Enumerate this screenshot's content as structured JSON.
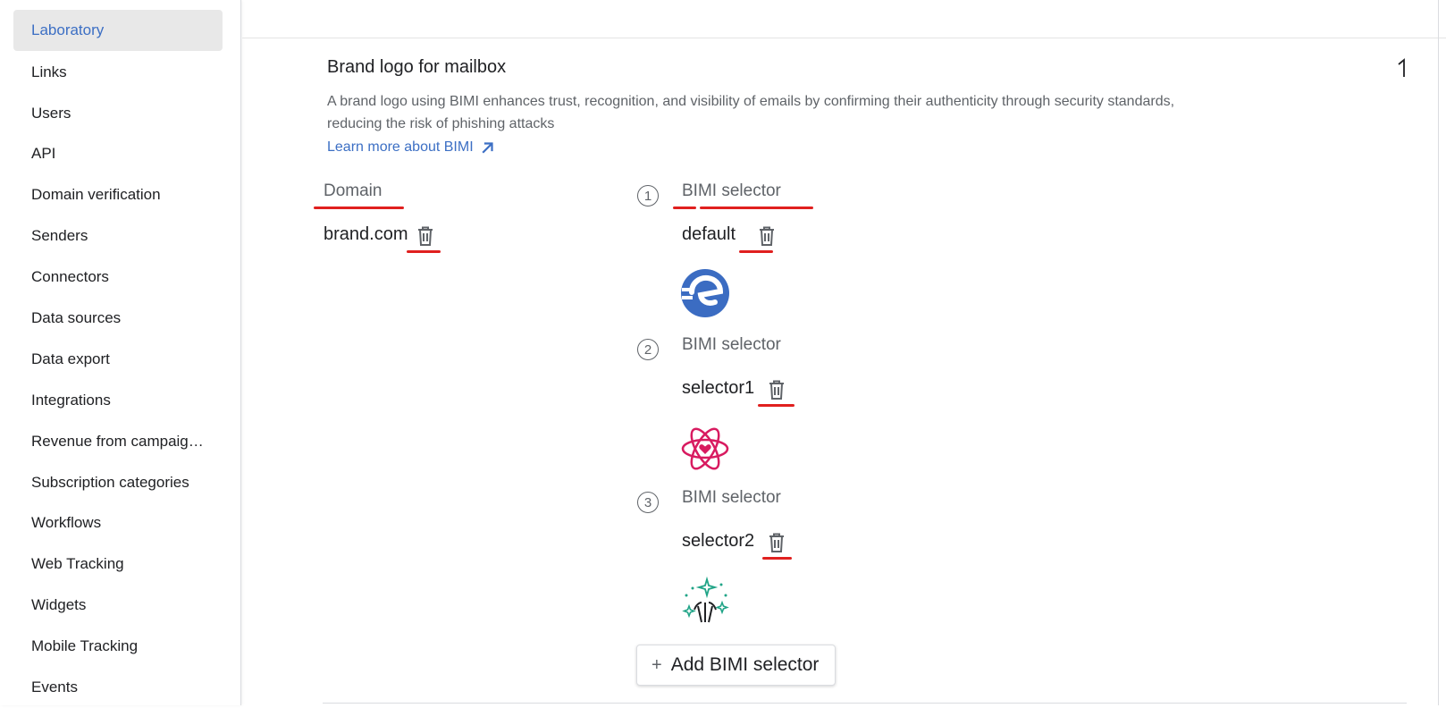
{
  "sidebar": {
    "items": [
      {
        "label": "Laboratory",
        "active": true
      },
      {
        "label": "Links"
      },
      {
        "label": "Users"
      },
      {
        "label": "API"
      },
      {
        "label": "Domain verification"
      },
      {
        "label": "Senders"
      },
      {
        "label": "Connectors"
      },
      {
        "label": "Data sources"
      },
      {
        "label": "Data export"
      },
      {
        "label": "Integrations"
      },
      {
        "label": "Revenue from campaig…"
      },
      {
        "label": "Subscription categories"
      },
      {
        "label": "Workflows"
      },
      {
        "label": "Web Tracking"
      },
      {
        "label": "Widgets"
      },
      {
        "label": "Mobile Tracking"
      },
      {
        "label": "Events"
      }
    ]
  },
  "brand_logo": {
    "title": "Brand logo for mailbox",
    "description": "A brand logo using BIMI enhances trust, recognition, and visibility of emails by confirming their authenticity through security standards, reducing the risk of phishing attacks",
    "learn_more": "Learn more about BIMI",
    "domain_label": "Domain",
    "domain_value": "brand.com",
    "selectors": [
      {
        "number": "1",
        "label": "BIMI selector",
        "value": "default",
        "logo": "brand-e-logo"
      },
      {
        "number": "2",
        "label": "BIMI selector",
        "value": "selector1",
        "logo": "atom-heart-logo"
      },
      {
        "number": "3",
        "label": "BIMI selector",
        "value": "selector2",
        "logo": "sparkles-logo"
      }
    ],
    "add_button": "Add BIMI selector"
  },
  "colors": {
    "accent": "#3c6fc4",
    "highlight_underline": "#e0201f",
    "active_bg": "#e8e8e8"
  }
}
